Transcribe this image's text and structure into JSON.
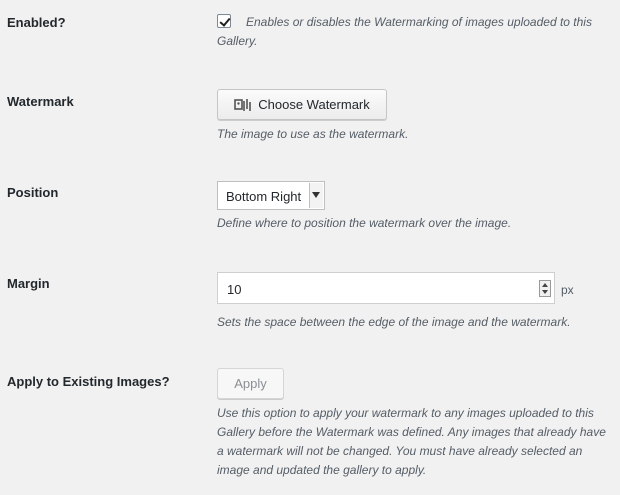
{
  "rows": {
    "enabled": {
      "label": "Enabled?",
      "checked": true,
      "description": "Enables or disables the Watermarking of images uploaded to this Gallery."
    },
    "watermark": {
      "label": "Watermark",
      "button_label": "Choose Watermark",
      "button_icon": "media-icon",
      "description": "The image to use as the watermark."
    },
    "position": {
      "label": "Position",
      "selected": "Bottom Right",
      "description": "Define where to position the watermark over the image."
    },
    "margin": {
      "label": "Margin",
      "value": "10",
      "unit": "px",
      "description": "Sets the space between the edge of the image and the watermark."
    },
    "apply_existing": {
      "label": "Apply to Existing Images?",
      "button_label": "Apply",
      "description": "Use this option to apply your watermark to any images uploaded to this Gallery before the Watermark was defined. Any images that already have a watermark will not be changed. You must have already selected an image and updated the gallery to apply."
    }
  }
}
